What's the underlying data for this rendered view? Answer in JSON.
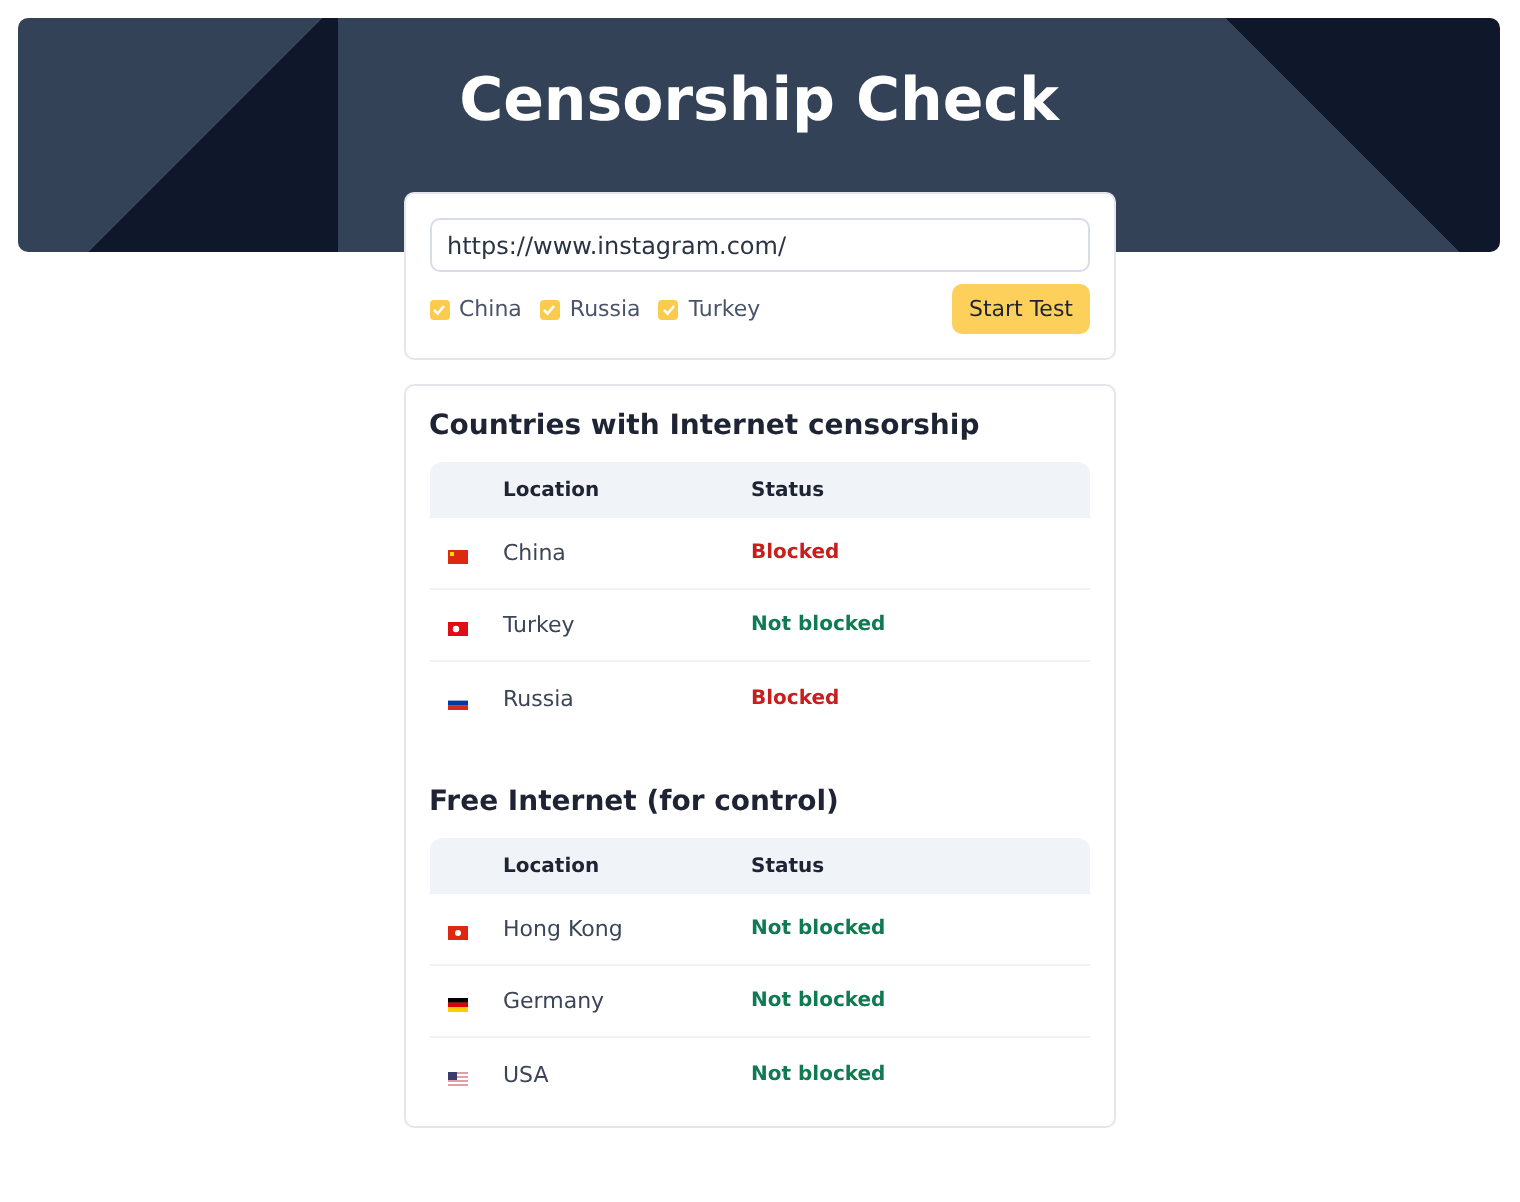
{
  "header": {
    "title": "Censorship Check"
  },
  "form": {
    "url": "https://www.instagram.com/",
    "countries": [
      {
        "label": "China",
        "checked": true
      },
      {
        "label": "Russia",
        "checked": true
      },
      {
        "label": "Turkey",
        "checked": true
      }
    ],
    "button": "Start Test"
  },
  "sections": [
    {
      "title": "Countries with Internet censorship",
      "columns": [
        "Location",
        "Status"
      ],
      "rows": [
        {
          "kind": "cn",
          "location": "China",
          "status": {
            "text": "Blocked",
            "kind": "blocked"
          }
        },
        {
          "kind": "tr",
          "location": "Turkey",
          "status": {
            "text": "Not blocked",
            "kind": "open"
          }
        },
        {
          "kind": "ru",
          "location": "Russia",
          "status": {
            "text": "Blocked",
            "kind": "blocked"
          }
        }
      ]
    },
    {
      "title": "Free Internet (for control)",
      "columns": [
        "Location",
        "Status"
      ],
      "rows": [
        {
          "kind": "hk",
          "location": "Hong Kong",
          "status": {
            "text": "Not blocked",
            "kind": "open"
          }
        },
        {
          "kind": "de",
          "location": "Germany",
          "status": {
            "text": "Not blocked",
            "kind": "open"
          }
        },
        {
          "kind": "us",
          "location": "USA",
          "status": {
            "text": "Not blocked",
            "kind": "open"
          }
        }
      ]
    }
  ]
}
